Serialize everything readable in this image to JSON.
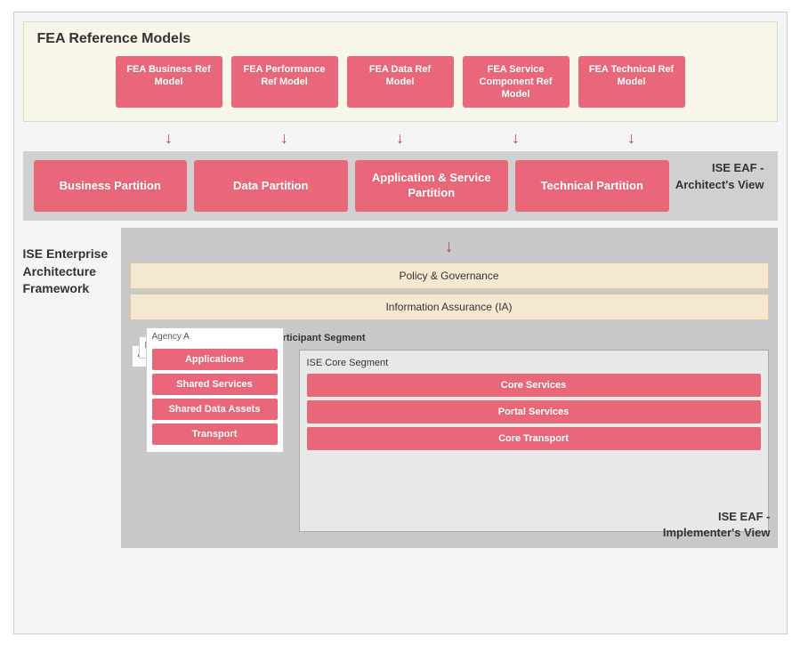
{
  "fea": {
    "title": "FEA Reference Models",
    "boxes": [
      {
        "id": "fea-business",
        "label": "FEA Business Ref Model"
      },
      {
        "id": "fea-performance",
        "label": "FEA Performance Ref Model"
      },
      {
        "id": "fea-data",
        "label": "FEA Data Ref Model"
      },
      {
        "id": "fea-service",
        "label": "FEA Service Component Ref Model"
      },
      {
        "id": "fea-technical",
        "label": "FEA Technical Ref Model"
      }
    ]
  },
  "partitions": {
    "label": "ISE EAF -\nArchitect's View",
    "items": [
      {
        "id": "business-partition",
        "label": "Business Partition"
      },
      {
        "id": "data-partition",
        "label": "Data Partition"
      },
      {
        "id": "app-service-partition",
        "label": "Application & Service Partition"
      },
      {
        "id": "technical-partition",
        "label": "Technical Partition"
      }
    ]
  },
  "ise_framework": {
    "left_label": "ISE Enterprise Architecture Framework",
    "policy_governance": "Policy & Governance",
    "information_assurance": "Information Assurance (IA)",
    "participant_segment_label": "ISE Participant Segment",
    "stacked_cards": [
      {
        "label": "Agency/Center ...",
        "z": 0
      },
      {
        "label": "Fusion Center X",
        "z": 1
      },
      {
        "label": "Agency A",
        "z": 2
      }
    ],
    "agency_boxes": [
      {
        "id": "applications",
        "label": "Applications"
      },
      {
        "id": "shared-services",
        "label": "Shared Services"
      },
      {
        "id": "shared-data-assets",
        "label": "Shared Data Assets"
      },
      {
        "id": "transport",
        "label": "Transport"
      }
    ],
    "core_segment": {
      "title": "ISE Core Segment",
      "boxes": [
        {
          "id": "core-services",
          "label": "Core Services"
        },
        {
          "id": "portal-services",
          "label": "Portal Services"
        },
        {
          "id": "core-transport",
          "label": "Core Transport"
        }
      ]
    },
    "implementer_label": "ISE EAF -\nImplementer's View"
  }
}
